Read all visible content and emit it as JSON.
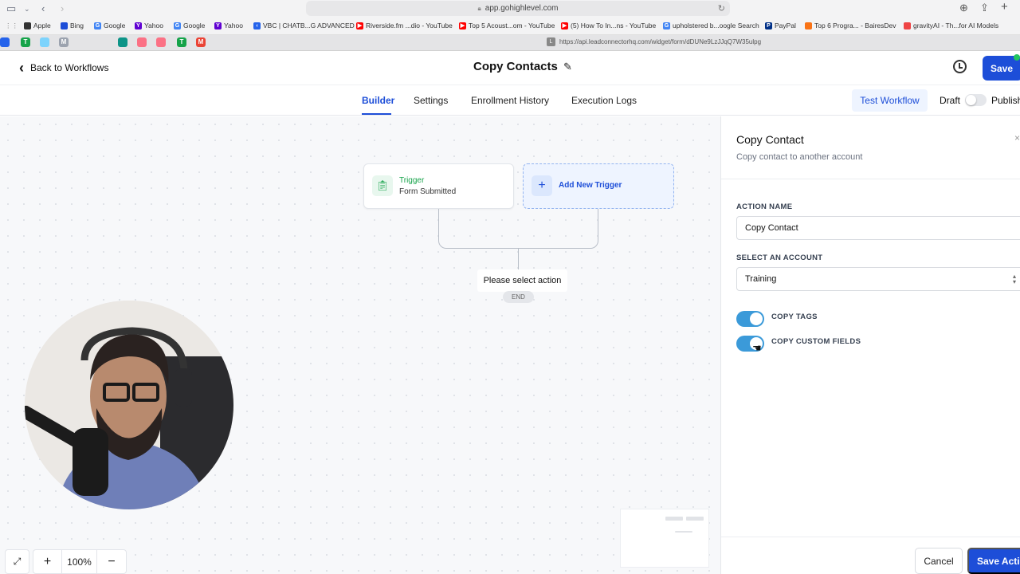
{
  "browser": {
    "address": "app.gohighlevel.com",
    "bookmarks": [
      {
        "label": "Apple",
        "icon": "apple-icon",
        "color": "#333333"
      },
      {
        "label": "Bing",
        "icon": "search-icon",
        "color": "#1d4ed8"
      },
      {
        "label": "Google",
        "icon": "google-icon",
        "color": "#4285f4"
      },
      {
        "label": "Yahoo",
        "icon": "yahoo-icon",
        "color": "#6001d2"
      },
      {
        "label": "Google",
        "icon": "google-icon",
        "color": "#4285f4"
      },
      {
        "label": "Yahoo",
        "icon": "yahoo-icon",
        "color": "#6001d2"
      },
      {
        "label": "VBC | CHATB...G ADVANCED",
        "icon": "vbc-icon",
        "color": "#2563eb"
      },
      {
        "label": "Riverside.fm ...dio - YouTube",
        "icon": "youtube-icon",
        "color": "#ff0000"
      },
      {
        "label": "Top 5 Acoust...om - YouTube",
        "icon": "youtube-icon",
        "color": "#ff0000"
      },
      {
        "label": "(5) How To In...ns - YouTube",
        "icon": "youtube-icon",
        "color": "#ff0000"
      },
      {
        "label": "upholstered b...oogle Search",
        "icon": "google-icon",
        "color": "#4285f4"
      },
      {
        "label": "PayPal",
        "icon": "paypal-icon",
        "color": "#003087"
      },
      {
        "label": "Top 6 Progra... - BairesDev",
        "icon": "bairesdev-icon",
        "color": "#f97316"
      },
      {
        "label": "gravityAI - Th...for AI Models",
        "icon": "gravityai-icon",
        "color": "#ef4444"
      }
    ],
    "tab_url": "https://api.leadconnectorhq.com/widget/form/dDUNe9LzJJqQ7W35ulpg",
    "tab_url_badge": "L"
  },
  "header": {
    "back_label": "Back to Workflows",
    "title": "Copy Contacts",
    "save_label": "Save"
  },
  "tabs": {
    "builder": "Builder",
    "settings": "Settings",
    "enrollment": "Enrollment History",
    "logs": "Execution Logs",
    "test": "Test Workflow",
    "draft": "Draft",
    "publish": "Publish"
  },
  "canvas": {
    "trigger_label": "Trigger",
    "trigger_sub": "Form Submitted",
    "add_trigger": "Add New Trigger",
    "select_action": "Please select action",
    "end": "END",
    "zoom": "100%"
  },
  "panel": {
    "title": "Copy Contact",
    "subtitle": "Copy contact to another account",
    "action_name_label": "ACTION NAME",
    "action_name_value": "Copy Contact",
    "account_label": "SELECT AN ACCOUNT",
    "account_value": "Training",
    "copy_tags": "COPY TAGS",
    "copy_tags_on": true,
    "copy_custom_fields": "COPY CUSTOM FIELDS",
    "copy_custom_fields_on": true,
    "cancel": "Cancel",
    "save_action": "Save Action"
  },
  "colors": {
    "primary": "#1d4ed8",
    "trigger_green": "#16a34a",
    "toggle_on": "#3b9ad9"
  }
}
